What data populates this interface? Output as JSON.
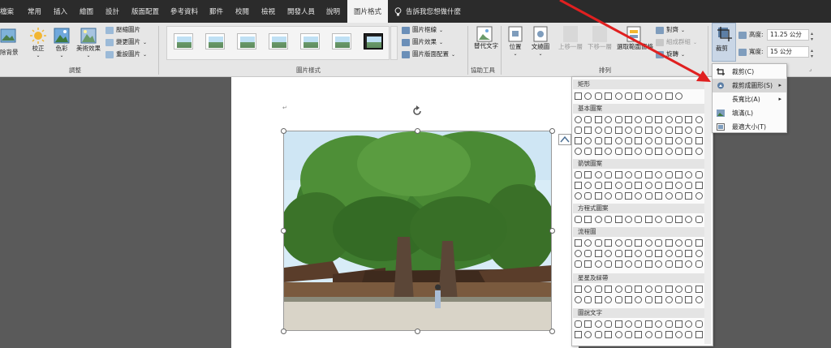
{
  "tabs": [
    {
      "label": "檔案"
    },
    {
      "label": "常用"
    },
    {
      "label": "插入"
    },
    {
      "label": "繪圖"
    },
    {
      "label": "設計"
    },
    {
      "label": "版面配置"
    },
    {
      "label": "參考資料"
    },
    {
      "label": "郵件"
    },
    {
      "label": "校閱"
    },
    {
      "label": "檢視"
    },
    {
      "label": "開發人員"
    },
    {
      "label": "說明"
    },
    {
      "label": "圖片格式",
      "active": true
    }
  ],
  "tell_me": "告訴我您想做什麼",
  "ribbon": {
    "adjust": {
      "label": "調整",
      "remove_bg": "除背景",
      "corrections": "校正",
      "color": "色彩",
      "artistic": "美術效果",
      "compress": "壓縮圖片",
      "change": "變更圖片",
      "reset": "重設圖片"
    },
    "styles": {
      "label": "圖片樣式",
      "border": "圖片框線",
      "effects": "圖片效果",
      "layout": "圖片版面配置"
    },
    "accessibility": {
      "label": "協助工具",
      "alt_text": "替代文字"
    },
    "arrange": {
      "label": "排列",
      "position": "位置",
      "wrap": "文繞圖",
      "forward": "上移一層",
      "backward": "下移一層",
      "selection_pane": "選取範圍窗格",
      "align": "對齊",
      "group": "組成群組",
      "rotate": "旋轉"
    },
    "size": {
      "crop": "裁剪",
      "height_label": "高度:",
      "height_value": "11.25 公分",
      "width_label": "寬度:",
      "width_value": "15 公分"
    }
  },
  "crop_menu": {
    "items": [
      {
        "label": "裁剪(C)"
      },
      {
        "label": "裁剪成圖形(S)",
        "highlighted": true,
        "submenu": true
      },
      {
        "label": "長寬比(A)",
        "submenu": true
      },
      {
        "label": "填滿(L)"
      },
      {
        "label": "最適大小(T)"
      }
    ]
  },
  "shapes_menu": {
    "sections": [
      {
        "title": "矩形"
      },
      {
        "title": "基本圖案"
      },
      {
        "title": "箭號圖案"
      },
      {
        "title": "方程式圖案"
      },
      {
        "title": "流程圖"
      },
      {
        "title": "星星及綵帶"
      },
      {
        "title": "圖說文字"
      }
    ]
  },
  "colors": {
    "tab_bar": "#2b2b2b",
    "ribbon": "#e6e6e6",
    "workspace": "#5a5a5a",
    "arrow": "#e02020"
  }
}
